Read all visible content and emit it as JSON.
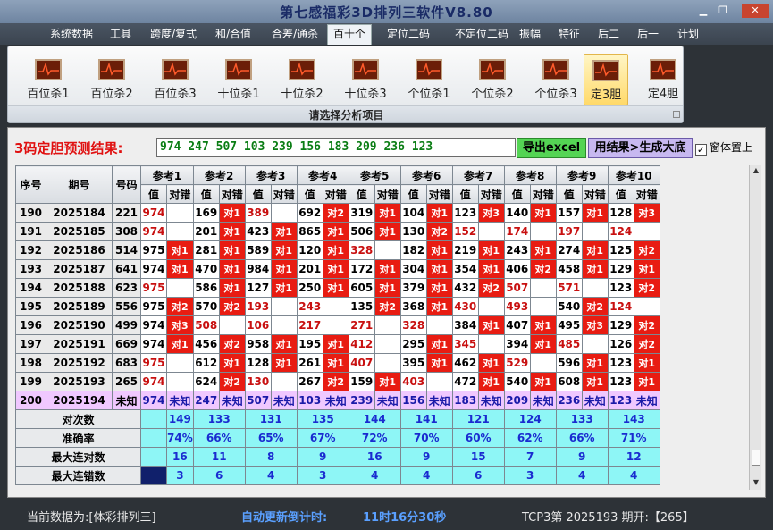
{
  "app": {
    "title": "第七感福彩3D排列三软件V8.80"
  },
  "menu": [
    "系统数据",
    "工具",
    "跨度/复式",
    "和/合值",
    "合差/通杀",
    "百十个",
    "定位二码",
    "不定位二码",
    "振幅",
    "特征",
    "后二",
    "后一",
    "计划"
  ],
  "menu_active_index": 5,
  "ribbon": {
    "buttons": [
      "百位杀1",
      "百位杀2",
      "百位杀3",
      "十位杀1",
      "十位杀2",
      "十位杀3",
      "个位杀1",
      "个位杀2",
      "个位杀3",
      "定3胆",
      "定4胆"
    ],
    "selected_index": 9,
    "caption": "请选择分析项目"
  },
  "prediction": {
    "label": "3码定胆预测结果:",
    "value": "974 247 507 103 239 156 183 209 236 123"
  },
  "buttons": {
    "export": "导出excel",
    "generate": "用结果>生成大底"
  },
  "topmost": {
    "label": "窗体置上",
    "checked": true
  },
  "table": {
    "headers": {
      "seq": "序号",
      "period": "期号",
      "number": "号码",
      "value": "值",
      "result": "对错"
    },
    "refs": [
      "参考1",
      "参考2",
      "参考3",
      "参考4",
      "参考5",
      "参考6",
      "参考7",
      "参考8",
      "参考9",
      "参考10"
    ],
    "rows": [
      {
        "seq": "190",
        "period": "2025184",
        "num": "221",
        "cells": [
          [
            "974",
            "",
            1
          ],
          [
            "169",
            "对1",
            0
          ],
          [
            "389",
            "",
            1
          ],
          [
            "692",
            "对2",
            0
          ],
          [
            "319",
            "对1",
            0
          ],
          [
            "104",
            "对1",
            0
          ],
          [
            "123",
            "对3",
            0
          ],
          [
            "140",
            "对1",
            0
          ],
          [
            "157",
            "对1",
            0
          ],
          [
            "128",
            "对3",
            0
          ]
        ]
      },
      {
        "seq": "191",
        "period": "2025185",
        "num": "308",
        "cells": [
          [
            "974",
            "",
            1
          ],
          [
            "201",
            "对1",
            0
          ],
          [
            "423",
            "对1",
            0
          ],
          [
            "865",
            "对1",
            0
          ],
          [
            "506",
            "对1",
            0
          ],
          [
            "130",
            "对2",
            0
          ],
          [
            "152",
            "",
            1
          ],
          [
            "174",
            "",
            1
          ],
          [
            "197",
            "",
            1
          ],
          [
            "124",
            "",
            1
          ]
        ]
      },
      {
        "seq": "192",
        "period": "2025186",
        "num": "514",
        "cells": [
          [
            "975",
            "对1",
            0
          ],
          [
            "281",
            "对1",
            0
          ],
          [
            "589",
            "对1",
            0
          ],
          [
            "120",
            "对1",
            0
          ],
          [
            "328",
            "",
            1
          ],
          [
            "182",
            "对1",
            0
          ],
          [
            "219",
            "对1",
            0
          ],
          [
            "243",
            "对1",
            0
          ],
          [
            "274",
            "对1",
            0
          ],
          [
            "125",
            "对2",
            0
          ]
        ]
      },
      {
        "seq": "193",
        "period": "2025187",
        "num": "641",
        "cells": [
          [
            "974",
            "对1",
            0
          ],
          [
            "470",
            "对1",
            0
          ],
          [
            "984",
            "对1",
            0
          ],
          [
            "201",
            "对1",
            0
          ],
          [
            "172",
            "对1",
            0
          ],
          [
            "304",
            "对1",
            0
          ],
          [
            "354",
            "对1",
            0
          ],
          [
            "406",
            "对2",
            0
          ],
          [
            "458",
            "对1",
            0
          ],
          [
            "129",
            "对1",
            0
          ]
        ]
      },
      {
        "seq": "194",
        "period": "2025188",
        "num": "623",
        "cells": [
          [
            "975",
            "",
            1
          ],
          [
            "586",
            "对1",
            0
          ],
          [
            "127",
            "对1",
            0
          ],
          [
            "250",
            "对1",
            0
          ],
          [
            "605",
            "对1",
            0
          ],
          [
            "379",
            "对1",
            0
          ],
          [
            "432",
            "对2",
            0
          ],
          [
            "507",
            "",
            1
          ],
          [
            "571",
            "",
            1
          ],
          [
            "123",
            "对2",
            0
          ]
        ]
      },
      {
        "seq": "195",
        "period": "2025189",
        "num": "556",
        "cells": [
          [
            "975",
            "对2",
            0
          ],
          [
            "570",
            "对2",
            0
          ],
          [
            "193",
            "",
            1
          ],
          [
            "243",
            "",
            1
          ],
          [
            "135",
            "对2",
            0
          ],
          [
            "368",
            "对1",
            0
          ],
          [
            "430",
            "",
            1
          ],
          [
            "493",
            "",
            1
          ],
          [
            "540",
            "对2",
            0
          ],
          [
            "124",
            "",
            1
          ]
        ]
      },
      {
        "seq": "196",
        "period": "2025190",
        "num": "499",
        "cells": [
          [
            "974",
            "对3",
            0
          ],
          [
            "508",
            "",
            1
          ],
          [
            "106",
            "",
            1
          ],
          [
            "217",
            "",
            1
          ],
          [
            "271",
            "",
            1
          ],
          [
            "328",
            "",
            1
          ],
          [
            "384",
            "对1",
            0
          ],
          [
            "407",
            "对1",
            0
          ],
          [
            "495",
            "对3",
            0
          ],
          [
            "129",
            "对2",
            0
          ]
        ]
      },
      {
        "seq": "197",
        "period": "2025191",
        "num": "669",
        "cells": [
          [
            "974",
            "对1",
            0
          ],
          [
            "456",
            "对2",
            0
          ],
          [
            "958",
            "对1",
            0
          ],
          [
            "195",
            "对1",
            0
          ],
          [
            "412",
            "",
            1
          ],
          [
            "295",
            "对1",
            0
          ],
          [
            "345",
            "",
            1
          ],
          [
            "394",
            "对1",
            0
          ],
          [
            "485",
            "",
            1
          ],
          [
            "126",
            "对2",
            0
          ]
        ]
      },
      {
        "seq": "198",
        "period": "2025192",
        "num": "683",
        "cells": [
          [
            "975",
            "",
            1
          ],
          [
            "612",
            "对1",
            0
          ],
          [
            "128",
            "对1",
            0
          ],
          [
            "261",
            "对1",
            0
          ],
          [
            "407",
            "",
            1
          ],
          [
            "395",
            "对1",
            0
          ],
          [
            "462",
            "对1",
            0
          ],
          [
            "529",
            "",
            1
          ],
          [
            "596",
            "对1",
            0
          ],
          [
            "123",
            "对1",
            0
          ]
        ]
      },
      {
        "seq": "199",
        "period": "2025193",
        "num": "265",
        "cells": [
          [
            "974",
            "",
            1
          ],
          [
            "624",
            "对2",
            0
          ],
          [
            "130",
            "",
            1
          ],
          [
            "267",
            "对2",
            0
          ],
          [
            "159",
            "对1",
            0
          ],
          [
            "403",
            "",
            1
          ],
          [
            "472",
            "对1",
            0
          ],
          [
            "540",
            "对1",
            0
          ],
          [
            "608",
            "对1",
            0
          ],
          [
            "123",
            "对1",
            0
          ]
        ]
      }
    ],
    "last_row": {
      "seq": "200",
      "period": "2025194",
      "num": "未知",
      "cells": [
        [
          "974",
          "未知"
        ],
        [
          "247",
          "未知"
        ],
        [
          "507",
          "未知"
        ],
        [
          "103",
          "未知"
        ],
        [
          "239",
          "未知"
        ],
        [
          "156",
          "未知"
        ],
        [
          "183",
          "未知"
        ],
        [
          "209",
          "未知"
        ],
        [
          "236",
          "未知"
        ],
        [
          "123",
          "未知"
        ]
      ]
    },
    "stats": [
      {
        "label": "对次数",
        "values": [
          "149",
          "133",
          "131",
          "135",
          "144",
          "141",
          "121",
          "124",
          "133",
          "143"
        ]
      },
      {
        "label": "准确率",
        "values": [
          "74%",
          "66%",
          "65%",
          "67%",
          "72%",
          "70%",
          "60%",
          "62%",
          "66%",
          "71%"
        ]
      },
      {
        "label": "最大连对数",
        "values": [
          "16",
          "11",
          "8",
          "9",
          "16",
          "9",
          "15",
          "7",
          "9",
          "12"
        ]
      },
      {
        "label": "最大连错数",
        "values": [
          "3",
          "6",
          "4",
          "3",
          "4",
          "4",
          "6",
          "3",
          "4",
          "4"
        ]
      }
    ]
  },
  "status": {
    "source": "当前数据为:[体彩排列三]",
    "countdown_label": "自动更新倒计时:",
    "countdown_value": "11时16分30秒",
    "draw_info": "TCP3第 2025193 期开:【265】"
  }
}
